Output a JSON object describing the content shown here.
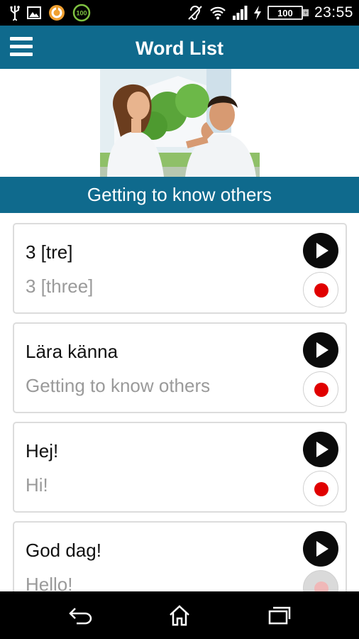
{
  "status_bar": {
    "time": "23:55",
    "battery_level": "100",
    "battery_cap_label": "+",
    "notification_badge": "100",
    "icons": [
      "usb-icon",
      "image-icon",
      "app-notification-icon",
      "battery-saver-icon",
      "hearing-aid-icon",
      "wifi-icon",
      "signal-icon",
      "charging-icon",
      "battery-icon"
    ]
  },
  "header": {
    "title": "Word List",
    "menu_icon": "hamburger-menu-icon"
  },
  "category": {
    "title": "Getting to know others"
  },
  "words": [
    {
      "word": "3 [tre]",
      "translation": "3 [three]"
    },
    {
      "word": "Lära känna",
      "translation": "Getting to know others"
    },
    {
      "word": "Hej!",
      "translation": "Hi!"
    },
    {
      "word": "God dag!",
      "translation": "Hello!"
    }
  ],
  "nav": {
    "icons": [
      "back-icon",
      "home-icon",
      "recent-apps-icon"
    ]
  },
  "colors": {
    "primary": "#0f6a8d",
    "record": "#e00000",
    "play": "#0b0b0b"
  }
}
